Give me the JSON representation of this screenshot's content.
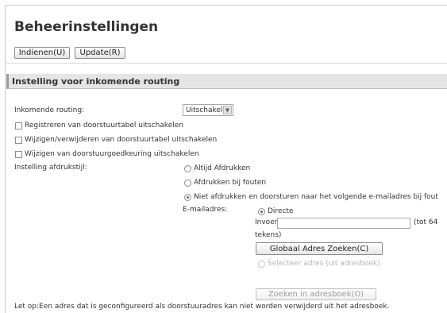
{
  "page": {
    "title": "Beheerinstellingen",
    "submit_label": "Indienen(U)",
    "update_label": "Update(R)"
  },
  "section": {
    "title": "Instelling voor inkomende routing"
  },
  "routing": {
    "label": "Inkomende routing:",
    "selected": "Uitschakelen"
  },
  "checkboxes": [
    {
      "label": "Registreren van doorstuurtabel uitschakelen",
      "checked": false
    },
    {
      "label": "Wijzigen/verwijderen van doorstuurtabel uitschakelen",
      "checked": false
    },
    {
      "label": "Wijzigen van doorstuurgoedkeuring uitschakelen",
      "checked": false
    }
  ],
  "print_style": {
    "label": "Instelling afdrukstijl:",
    "options": [
      {
        "label": "Altijd Afdrukken",
        "checked": false
      },
      {
        "label": "Afdrukken bij fouten",
        "checked": false
      },
      {
        "label": "Niet afdrukken en doorsturen naar het volgende e-mailadres bij fout",
        "checked": true
      }
    ]
  },
  "email": {
    "label": "E-mailadres:",
    "direct_label": "Directe",
    "input_label": "Invoer:",
    "input_value": "",
    "limit_text_1": "(tot 64",
    "limit_text_2": "tekens)",
    "global_search_button": "Globaal Adres Zoeken(C)",
    "select_addressbook_label": "Selecteer adres (uit adresboek)",
    "search_addressbook_button": "Zoeken in adresboek(O)"
  },
  "note": "Let op:Een adres dat is geconfigureerd als doorstuuradres kan niet worden verwijderd uit het adresboek."
}
